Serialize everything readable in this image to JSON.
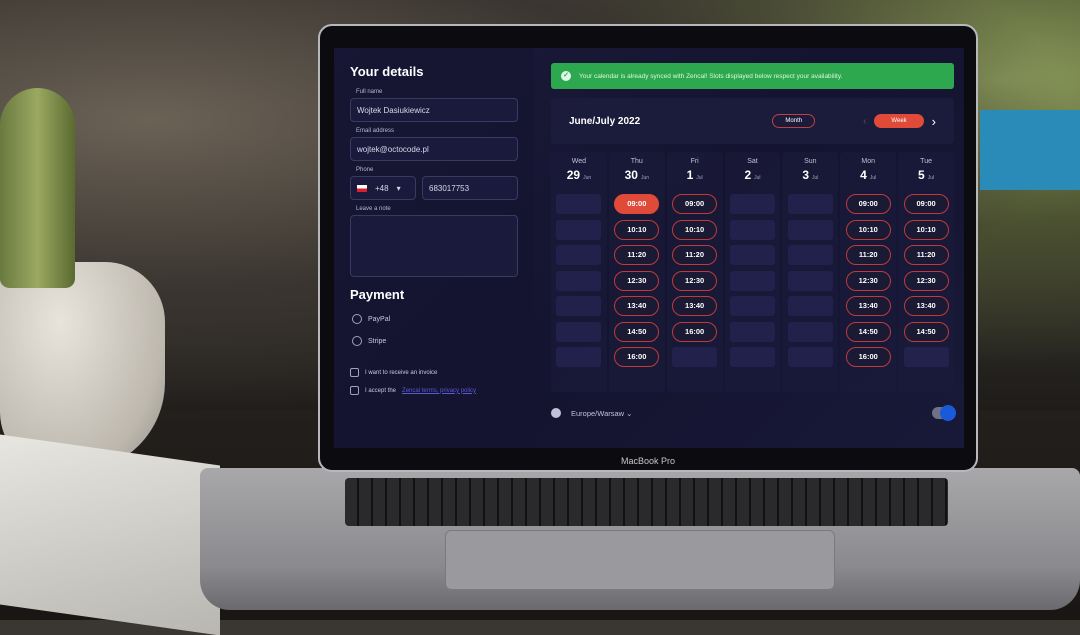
{
  "laptop": {
    "brand": "MacBook Pro"
  },
  "details": {
    "title": "Your details",
    "full_name": {
      "label": "Full name",
      "value": "Wojtek Dasiukiewicz"
    },
    "email": {
      "label": "Email address",
      "value": "wojtek@octocode.pl"
    },
    "phone": {
      "label": "Phone",
      "country_code": "+48",
      "value": "683017753"
    },
    "note": {
      "label": "Leave a note",
      "value": ""
    }
  },
  "payment": {
    "title": "Payment",
    "options": [
      "PayPal",
      "Stripe"
    ]
  },
  "checkboxes": {
    "invoice": "I want to receive an invoice",
    "accept": "I accept the",
    "accept_link": "Zencal terms, privacy policy"
  },
  "banner": {
    "text": "Your calendar is already synced with Zencal! Slots displayed below respect your availability."
  },
  "calendar": {
    "title": "June/July 2022",
    "month_label": "Month",
    "week_label": "Week",
    "days": [
      {
        "name": "Wed",
        "date": "29",
        "month": "Jun",
        "slots": []
      },
      {
        "name": "Thu",
        "date": "30",
        "month": "Jun",
        "slots": [
          "09:00",
          "10:10",
          "11:20",
          "12:30",
          "13:40",
          "14:50",
          "16:00"
        ],
        "selected": "09:00"
      },
      {
        "name": "Fri",
        "date": "1",
        "month": "Jul",
        "slots": [
          "09:00",
          "10:10",
          "11:20",
          "12:30",
          "13:40",
          "16:00"
        ]
      },
      {
        "name": "Sat",
        "date": "2",
        "month": "Jul",
        "slots": []
      },
      {
        "name": "Sun",
        "date": "3",
        "month": "Jul",
        "slots": []
      },
      {
        "name": "Mon",
        "date": "4",
        "month": "Jul",
        "slots": [
          "09:00",
          "10:10",
          "11:20",
          "12:30",
          "13:40",
          "14:50",
          "16:00"
        ]
      },
      {
        "name": "Tue",
        "date": "5",
        "month": "Jul",
        "slots": [
          "09:00",
          "10:10",
          "11:20",
          "12:30",
          "13:40",
          "14:50"
        ]
      }
    ],
    "timezone": "Europe/Warsaw"
  }
}
